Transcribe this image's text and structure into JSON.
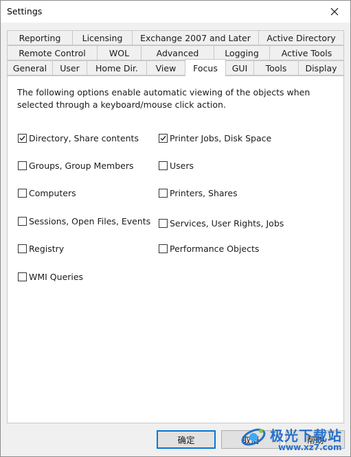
{
  "window": {
    "title": "Settings"
  },
  "tabs": {
    "row1": [
      "Reporting",
      "Licensing",
      "Exchange 2007 and Later",
      "Active Directory"
    ],
    "row2": [
      "Remote Control",
      "WOL",
      "Advanced",
      "Logging",
      "Active Tools"
    ],
    "row3": [
      "General",
      "User",
      "Home Dir.",
      "View",
      "Focus",
      "GUI",
      "Tools",
      "Display"
    ],
    "active": "Focus"
  },
  "focus": {
    "description": "The following options enable automatic viewing of the objects when selected through a keyboard/mouse click action.",
    "options": [
      {
        "label": "Directory, Share contents",
        "checked": true
      },
      {
        "label": "Printer Jobs, Disk Space",
        "checked": true
      },
      {
        "label": "Groups, Group Members",
        "checked": false
      },
      {
        "label": "Users",
        "checked": false
      },
      {
        "label": "Computers",
        "checked": false
      },
      {
        "label": "Printers, Shares",
        "checked": false
      },
      {
        "label": "Sessions, Open Files, Events",
        "checked": false
      },
      {
        "label": "Services, User Rights, Jobs",
        "checked": false
      },
      {
        "label": "Registry",
        "checked": false
      },
      {
        "label": "Performance Objects",
        "checked": false
      },
      {
        "label": "WMI Queries",
        "checked": false
      }
    ]
  },
  "buttons": {
    "ok": "确定",
    "cancel": "取消",
    "help": "帮助"
  },
  "watermark": {
    "text": "极光下载站",
    "url": "www.xz7.com"
  },
  "colors": {
    "accent": "#0078d7",
    "watermark": "#2470c9"
  }
}
